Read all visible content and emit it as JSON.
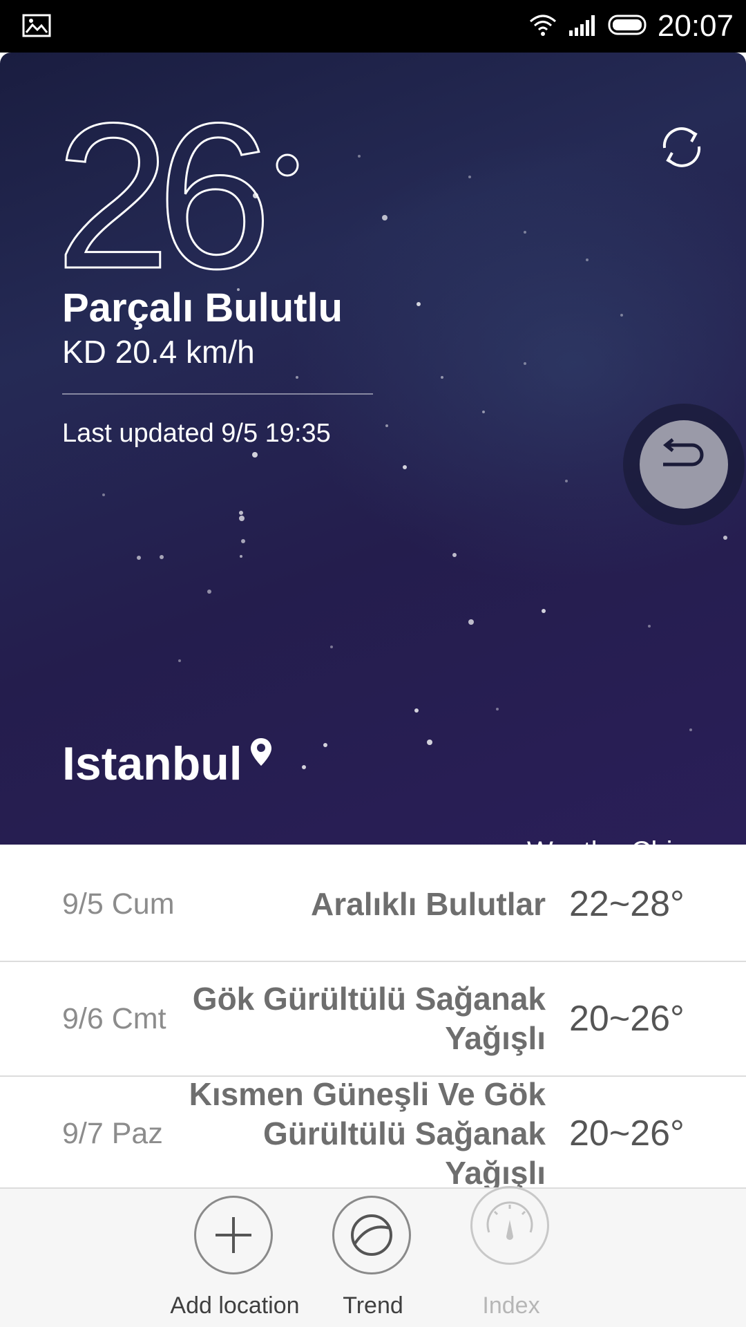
{
  "status_bar": {
    "time": "20:07",
    "icons": [
      "gallery-icon",
      "wifi-icon",
      "signal-icon",
      "battery-icon"
    ]
  },
  "current": {
    "temperature": "26",
    "degree_symbol": "°",
    "condition": "Parçalı Bulutlu",
    "wind": "KD 20.4 km/h",
    "last_updated": "Last updated 9/5 19:35",
    "city": "Istanbul",
    "source": "WeatherChina"
  },
  "forecast": [
    {
      "date": "9/5 Cum",
      "condition": "Aralıklı Bulutlar",
      "temp": "22~28°"
    },
    {
      "date": "9/6 Cmt",
      "condition": "Gök Gürültülü Sağanak Yağışlı",
      "temp": "20~26°"
    },
    {
      "date": "9/7 Paz",
      "condition": "Kısmen Güneşli Ve Gök Gürültülü Sağanak Yağışlı",
      "temp": "20~26°"
    }
  ],
  "bottom_bar": {
    "add_location": "Add location",
    "trend": "Trend",
    "index": "Index"
  },
  "colors": {
    "hero_bg": "#232650",
    "text_secondary": "#8c8c8c",
    "bar_bg": "#f6f6f6"
  }
}
